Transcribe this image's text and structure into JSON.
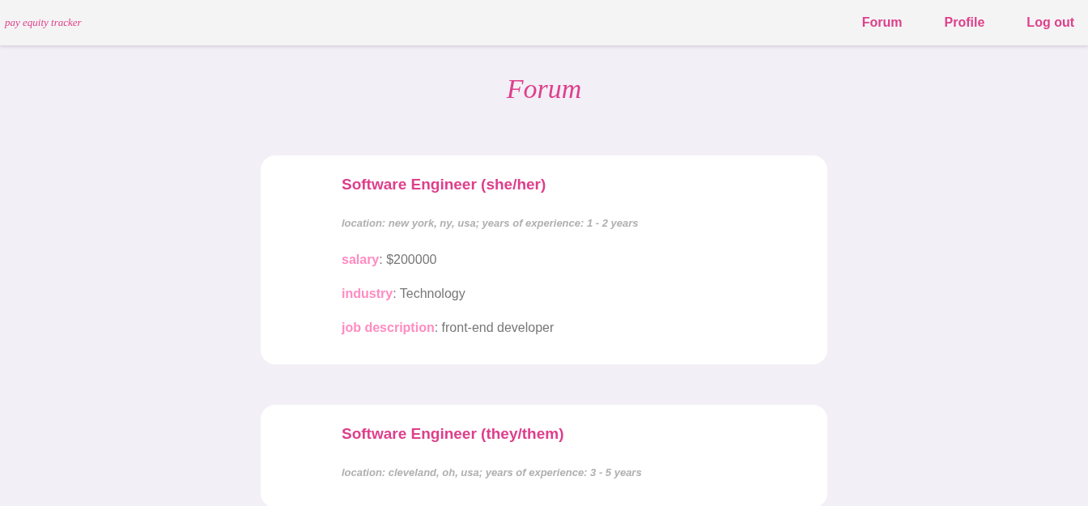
{
  "navbar": {
    "logo": "pay equity tracker",
    "links": [
      {
        "label": "Forum"
      },
      {
        "label": "Profile"
      },
      {
        "label": "Log out"
      }
    ]
  },
  "page_title": "Forum",
  "posts": [
    {
      "title": "Software Engineer (she/her)",
      "meta": "location: new york, ny, usa; years of experience: 1 - 2 years",
      "details": [
        "**salary**: $200000",
        "**industry**: Technology",
        "**job description**: front-end developer"
      ]
    },
    {
      "title": "Software Engineer (they/them)",
      "meta": "location: cleveland, oh, usa; years of experience: 3 - 5 years"
    }
  ]
}
